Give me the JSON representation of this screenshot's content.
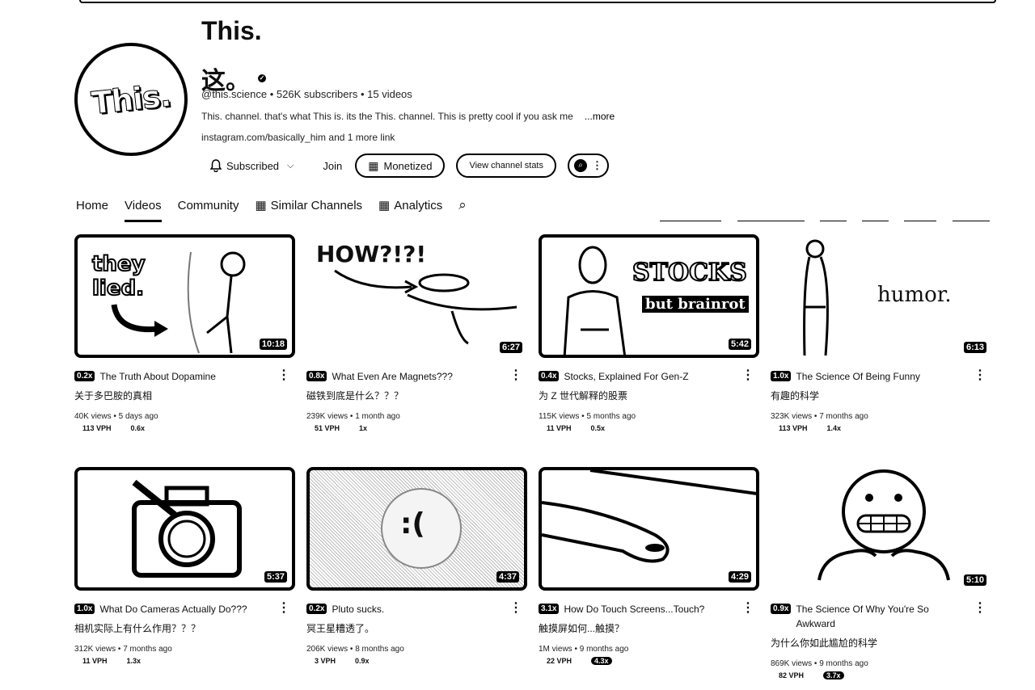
{
  "channel": {
    "title": "This.",
    "subtitle": "这。",
    "avatar_text": "This.",
    "handle": "@this.science",
    "subscribers": "526K subscribers",
    "videos_count": "15 videos",
    "description": "This. channel. that's what This is. its the This. channel. This is pretty cool if you ask me",
    "more": "...more",
    "links": "instagram.com/basically_him and 1 more link"
  },
  "actions": {
    "subscribed": "Subscribed",
    "join": "Join",
    "monetized": "Monetized",
    "stats": "View channel stats"
  },
  "tabs": [
    "Home",
    "Videos",
    "Community",
    "Similar Channels",
    "Analytics"
  ],
  "videos": [
    {
      "mult": "0.2x",
      "title": "The Truth About Dopamine",
      "cn": "关于多巴胺的真相",
      "views": "40K views",
      "age": "5 days ago",
      "vph": "113 VPH",
      "ratio": "0.6x",
      "duration": "10:18",
      "thumb_text": "they lied."
    },
    {
      "mult": "0.8x",
      "title": "What Even Are Magnets???",
      "cn": "磁铁到底是什么？？？",
      "views": "239K views",
      "age": "1 month ago",
      "vph": "51 VPH",
      "ratio": "1x",
      "duration": "6:27",
      "thumb_text": "HOW?!?!"
    },
    {
      "mult": "0.4x",
      "title": "Stocks, Explained For Gen-Z",
      "cn": "为 Z 世代解释的股票",
      "views": "115K views",
      "age": "5 months ago",
      "vph": "11 VPH",
      "ratio": "0.5x",
      "duration": "5:42",
      "thumb_text": "STOCKS",
      "thumb_text2": "but brainrot"
    },
    {
      "mult": "1.0x",
      "title": "The Science Of Being Funny",
      "cn": "有趣的科学",
      "views": "323K views",
      "age": "7 months ago",
      "vph": "113 VPH",
      "ratio": "1.4x",
      "duration": "6:13",
      "thumb_text": "humor."
    },
    {
      "mult": "1.0x",
      "title": "What Do Cameras Actually Do???",
      "cn": "相机实际上有什么作用？？？",
      "views": "312K views",
      "age": "7 months ago",
      "vph": "11 VPH",
      "ratio": "1.3x",
      "duration": "5:37"
    },
    {
      "mult": "0.2x",
      "title": "Pluto sucks.",
      "cn": "冥王星糟透了。",
      "views": "206K views",
      "age": "8 months ago",
      "vph": "3 VPH",
      "ratio": "0.9x",
      "duration": "4:37",
      "thumb_text": ":("
    },
    {
      "mult": "3.1x",
      "title": "How Do Touch Screens...Touch?",
      "cn": "触摸屏如何...触摸？",
      "views": "1M views",
      "age": "9 months ago",
      "vph": "22 VPH",
      "ratio": "4.3x",
      "duration": "4:29"
    },
    {
      "mult": "0.9x",
      "title": "The Science Of Why You're So Awkward",
      "cn": "为什么你如此尴尬的科学",
      "views": "869K views",
      "age": "9 months ago",
      "vph": "82 VPH",
      "ratio": "3.7x",
      "duration": "5:10"
    }
  ]
}
